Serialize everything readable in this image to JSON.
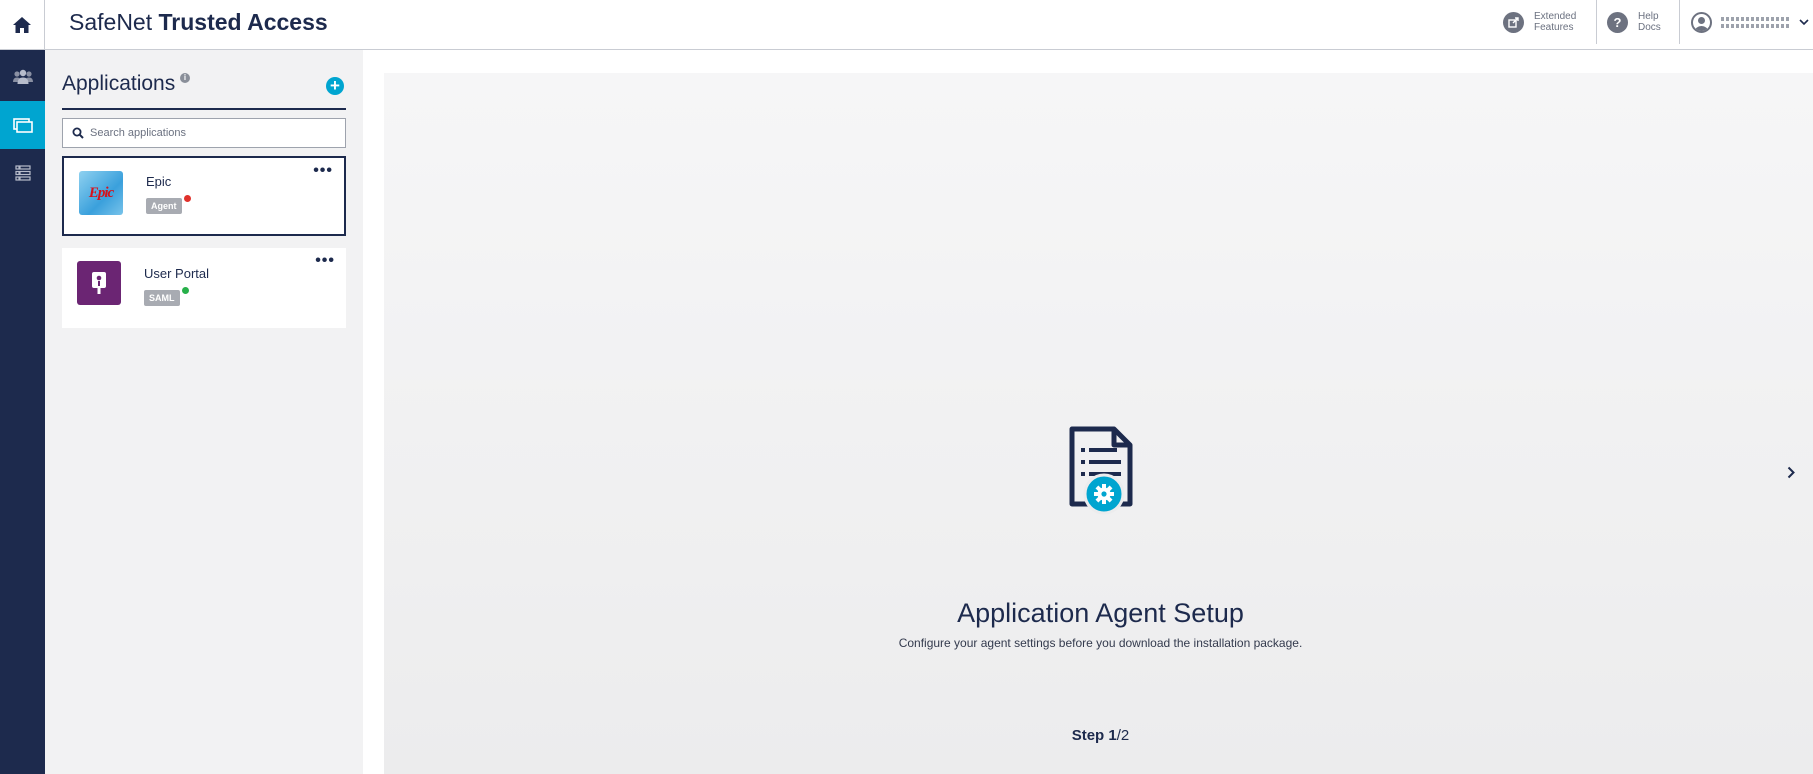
{
  "brand": {
    "name_regular": "SafeNet",
    "name_bold": "Trusted Access"
  },
  "header": {
    "extended_features": {
      "line1": "Extended",
      "line2": "Features"
    },
    "help_docs": {
      "line1": "Help",
      "line2": "Docs"
    }
  },
  "leftnav": {
    "items": [
      {
        "icon": "users-icon",
        "active": false
      },
      {
        "icon": "applications-icon",
        "active": true
      },
      {
        "icon": "list-icon",
        "active": false
      }
    ]
  },
  "applications": {
    "title": "Applications",
    "search_placeholder": "Search applications",
    "items": [
      {
        "name": "Epic",
        "logo_text": "Epic",
        "badge": "Agent",
        "status_color": "#e0312b",
        "selected": true
      },
      {
        "name": "User Portal",
        "badge": "SAML",
        "status_color": "#27b04a",
        "selected": false
      }
    ]
  },
  "main": {
    "title": "Application Agent Setup",
    "description": "Configure your agent settings before you download the installation package.",
    "step_label": "Step",
    "step_current": "1",
    "step_total": "/2"
  },
  "colors": {
    "navy": "#1d2a4d",
    "accent": "#00a5d0",
    "portal": "#6b2573"
  }
}
